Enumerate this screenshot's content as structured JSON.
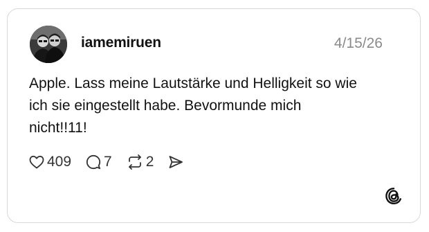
{
  "post": {
    "username": "iamemiruen",
    "date": "4/15/26",
    "text_lines": [
      "Apple. Lass meine Lautstärke und Helligkeit so wie",
      "ich sie eingestellt habe. Bevormunde mich",
      "nicht!!11!"
    ],
    "actions": {
      "like_icon": "heart-icon",
      "like_count": "409",
      "reply_icon": "comment-bubble-icon",
      "reply_count": "7",
      "repost_icon": "repost-icon",
      "repost_count": "2",
      "share_icon": "send-icon"
    }
  },
  "branding": {
    "logo_icon": "threads-logo-icon"
  },
  "colors": {
    "card_border": "#d8d8d8",
    "date_text": "#8a8a8a",
    "text": "#111111"
  }
}
